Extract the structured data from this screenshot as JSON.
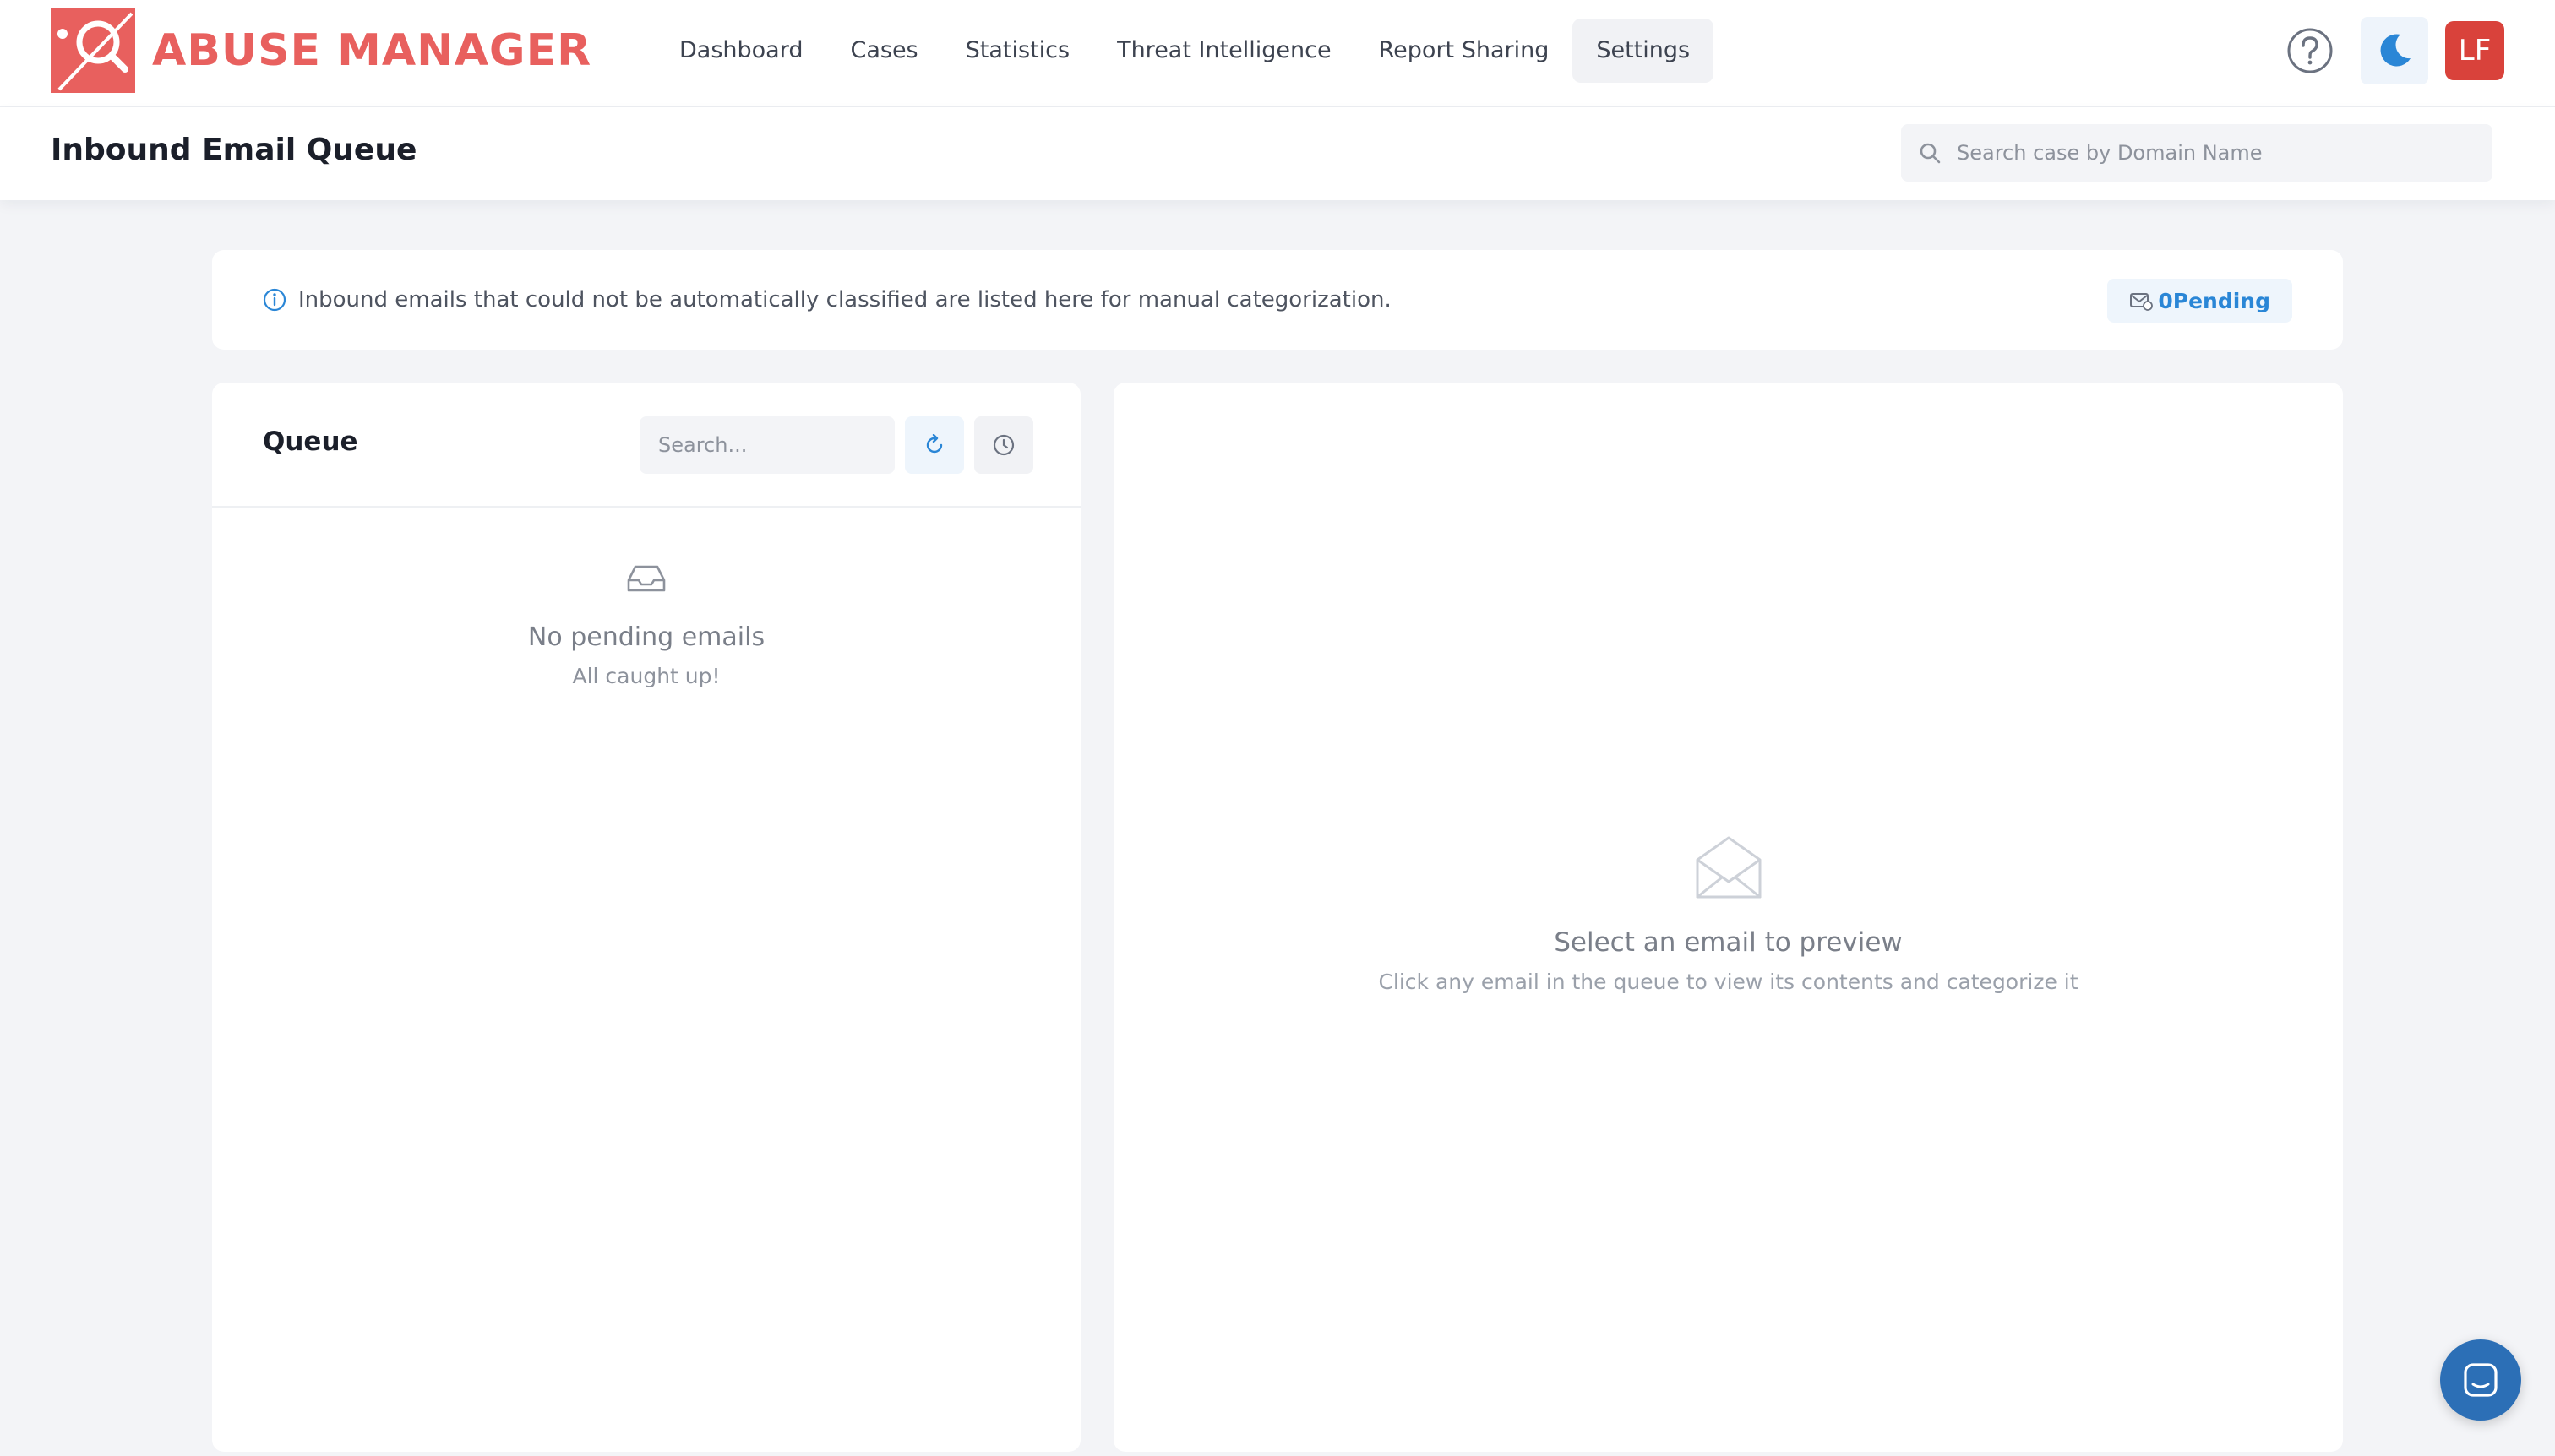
{
  "brand": {
    "name": "ABUSE MANAGER",
    "color": "#e8605e"
  },
  "nav": {
    "items": [
      {
        "label": "Dashboard"
      },
      {
        "label": "Cases"
      },
      {
        "label": "Statistics"
      },
      {
        "label": "Threat Intelligence"
      },
      {
        "label": "Report Sharing"
      },
      {
        "label": "Settings",
        "active": true
      }
    ]
  },
  "header": {
    "help_icon": "question-circle-icon",
    "theme_icon": "moon-icon",
    "user_initials": "LF",
    "avatar_color": "#d9423b"
  },
  "page": {
    "title": "Inbound Email Queue",
    "search_placeholder": "Search case by Domain Name"
  },
  "banner": {
    "info_icon": "info-circle-icon",
    "text": "Inbound emails that could not be automatically classified are listed here for manual categorization.",
    "pending_count": "0",
    "pending_label": "Pending",
    "accent": "#2a86d6"
  },
  "queue": {
    "title": "Queue",
    "search_placeholder": "Search...",
    "refresh_icon": "refresh-icon",
    "history_icon": "clock-icon",
    "empty_icon": "inbox-icon",
    "empty_title": "No pending emails",
    "empty_subtitle": "All caught up!"
  },
  "preview": {
    "empty_icon": "open-envelope-icon",
    "title": "Select an email to preview",
    "subtitle": "Click any email in the queue to view its contents and categorize it"
  },
  "chat": {
    "icon": "chat-icon",
    "color": "#2c6fb6"
  }
}
